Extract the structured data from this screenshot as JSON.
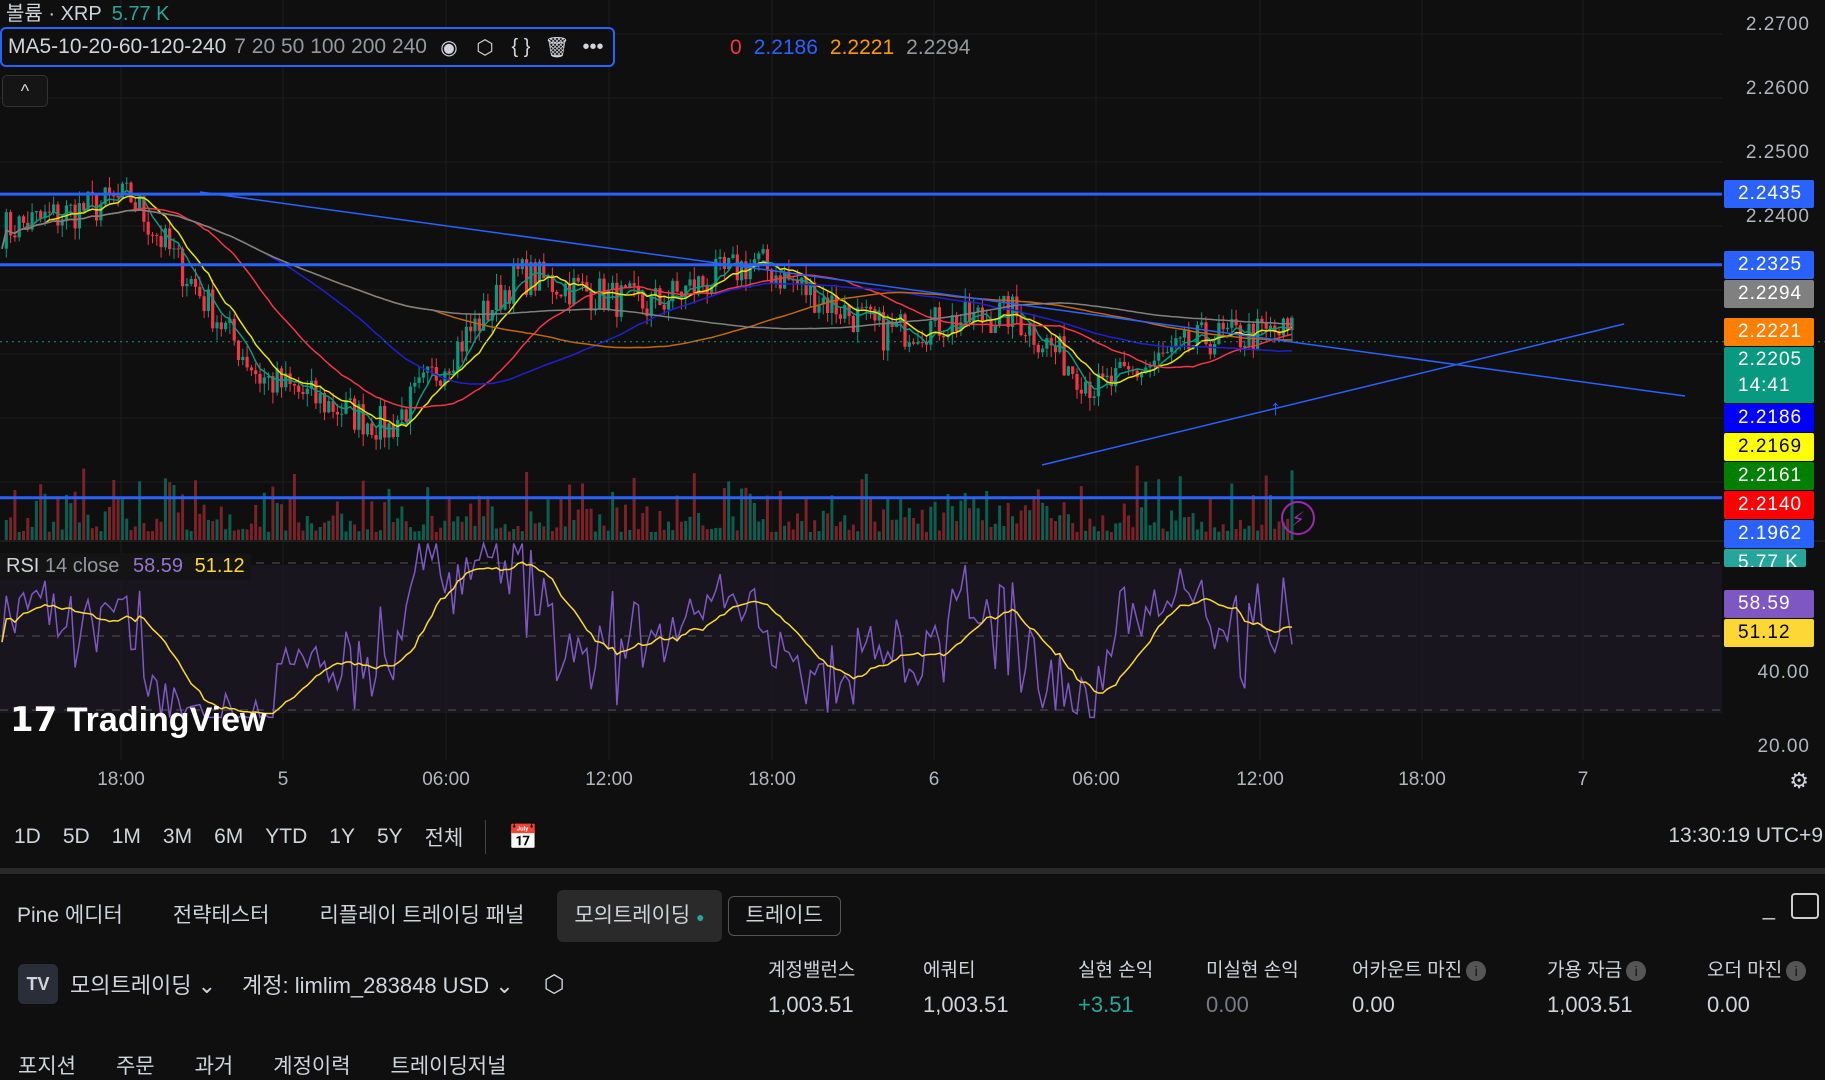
{
  "legend": {
    "title": "볼륨 · XRP",
    "value": "5.77 K"
  },
  "ma_indicator": {
    "name": "MA5-10-20-60-120-240",
    "params": "7 20 50 100 200 240",
    "values": [
      {
        "text": "0",
        "color": "#f23645"
      },
      {
        "text": "2.2186",
        "color": "#2962ff"
      },
      {
        "text": "2.2221",
        "color": "#ff9800"
      },
      {
        "text": "2.2294",
        "color": "#9598a1"
      }
    ]
  },
  "price_axis": [
    "2.2700",
    "2.2600",
    "2.2500",
    "2.2400"
  ],
  "price_tags": [
    {
      "text": "2.2435",
      "bg": "#2962ff",
      "fg": "#fff",
      "price": 2.2435
    },
    {
      "text": "2.2325",
      "bg": "#2962ff",
      "fg": "#fff",
      "price": 2.2325
    },
    {
      "text": "2.2294",
      "bg": "#808080",
      "fg": "#fff",
      "price": 2.2294
    },
    {
      "text": "2.2221",
      "bg": "#ff8000",
      "fg": "#fff",
      "price": 2.2221
    },
    {
      "text": "2.2205",
      "sub": "14:41",
      "bg": "#089981",
      "fg": "#fff",
      "price": 2.2205
    },
    {
      "text": "2.2186",
      "bg": "#0000ff",
      "fg": "#fff",
      "price": 2.2186
    },
    {
      "text": "2.2169",
      "bg": "#ffff00",
      "fg": "#000",
      "price": 2.2169
    },
    {
      "text": "2.2161",
      "bg": "#008000",
      "fg": "#fff",
      "price": 2.2161
    },
    {
      "text": "2.2140",
      "bg": "#ff0000",
      "fg": "#fff",
      "price": 2.214
    },
    {
      "text": "2.1962",
      "bg": "#2962ff",
      "fg": "#fff",
      "price": 2.1962
    },
    {
      "text": "5.77 K",
      "bg": "#26a69a",
      "fg": "#fff",
      "price": 2.192
    }
  ],
  "rsi": {
    "label": "RSI",
    "params": "14 close",
    "value": "58.59",
    "ma_value": "51.12",
    "axis": [
      "40.00",
      "20.00"
    ],
    "value_num": 58.59,
    "ma_num": 51.12
  },
  "time_axis": [
    "18:00",
    "5",
    "06:00",
    "12:00",
    "18:00",
    "6",
    "06:00",
    "12:00",
    "18:00",
    "7"
  ],
  "watermark": "TradingView",
  "range_buttons": [
    "1D",
    "5D",
    "1M",
    "3M",
    "6M",
    "YTD",
    "1Y",
    "5Y",
    "전체"
  ],
  "clock": "13:30:19 UTC+9",
  "panel_tabs": [
    "Pine 에디터",
    "전략테스터",
    "리플레이 트레이딩 패널",
    "모의트레이딩",
    "트레이드"
  ],
  "account": {
    "broker": "모의트레이딩",
    "account": "계정: limlim_283848 USD"
  },
  "stats": [
    {
      "label": "계정밸런스",
      "value": "1,003.51",
      "color": "#d1d4dc"
    },
    {
      "label": "에쿼티",
      "value": "1,003.51",
      "color": "#d1d4dc"
    },
    {
      "label": "실현 손익",
      "value": "+3.51",
      "color": "#26a69a"
    },
    {
      "label": "미실현 손익",
      "value": "0.00",
      "color": "#787b86"
    },
    {
      "label": "어카운트 마진",
      "value": "0.00",
      "color": "#d1d4dc",
      "info": true
    },
    {
      "label": "가용 자금",
      "value": "1,003.51",
      "color": "#d1d4dc",
      "info": true
    },
    {
      "label": "오더 마진",
      "value": "0.00",
      "color": "#d1d4dc",
      "info": true
    }
  ],
  "bottom_tabs": [
    "포지션",
    "주문",
    "과거",
    "계정이력",
    "트레이딩저널"
  ]
}
